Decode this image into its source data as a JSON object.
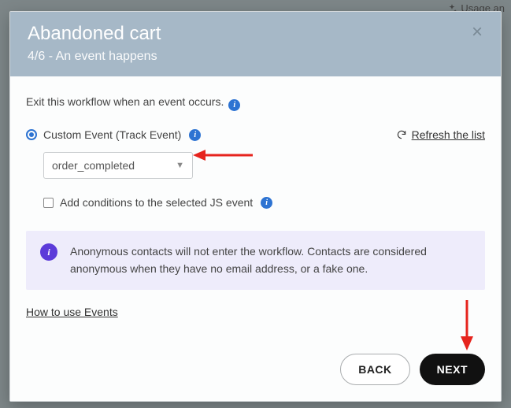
{
  "background": {
    "usage_chip": "Usage an"
  },
  "modal": {
    "title": "Abandoned cart",
    "subtitle": "4/6 - An event happens",
    "exit_text": "Exit this workflow when an event occurs.",
    "radio_label": "Custom Event (Track Event)",
    "refresh_label": "Refresh the list",
    "select_value": "order_completed",
    "checkbox_label": "Add conditions to the selected JS event",
    "alert_text": "Anonymous contacts will not enter the workflow. Contacts are considered anonymous when they have no email address, or a fake one.",
    "howto_label": "How to use Events",
    "back_label": "BACK",
    "next_label": "NEXT"
  }
}
